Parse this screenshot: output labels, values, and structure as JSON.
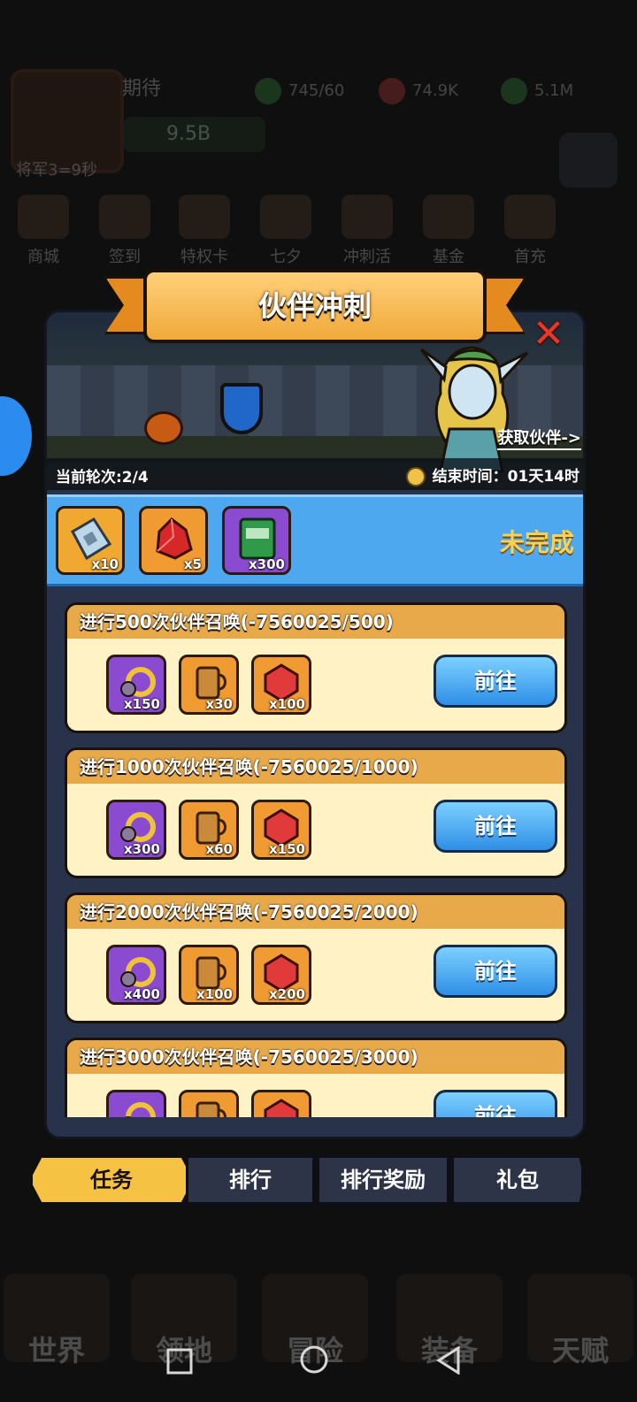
{
  "background": {
    "player_name": "期待",
    "power": "9.5B",
    "level_text": "将军3=9秒",
    "resources": [
      "745/60",
      "74.9K",
      "5.1M"
    ],
    "top_icons": [
      "商城",
      "签到",
      "特权卡",
      "七夕",
      "冲刺活动",
      "基金",
      "首充"
    ],
    "bottom_nav": [
      "世界",
      "领地",
      "冒险",
      "装备",
      "天赋"
    ]
  },
  "dialog": {
    "title": "伙伴冲刺",
    "get_partner_link": "获取伙伴->",
    "current_round": "当前轮次:2/4",
    "end_time": "结束时间：01天14时",
    "round_rewards": [
      {
        "icon": "ticket-icon",
        "count": "x10"
      },
      {
        "icon": "red-crystal-icon",
        "count": "x5"
      },
      {
        "icon": "exp-book-icon",
        "count": "x300"
      }
    ],
    "round_status": "未完成",
    "tasks": [
      {
        "title": "进行500次伙伴召唤(-7560025/500)",
        "button": "前往",
        "rewards": [
          {
            "icon": "summon-key-icon",
            "count": "x150"
          },
          {
            "icon": "beer-mug-icon",
            "count": "x30"
          },
          {
            "icon": "red-gem-icon",
            "count": "x100"
          }
        ]
      },
      {
        "title": "进行1000次伙伴召唤(-7560025/1000)",
        "button": "前往",
        "rewards": [
          {
            "icon": "summon-key-icon",
            "count": "x300"
          },
          {
            "icon": "beer-mug-icon",
            "count": "x60"
          },
          {
            "icon": "red-gem-icon",
            "count": "x150"
          }
        ]
      },
      {
        "title": "进行2000次伙伴召唤(-7560025/2000)",
        "button": "前往",
        "rewards": [
          {
            "icon": "summon-key-icon",
            "count": "x400"
          },
          {
            "icon": "beer-mug-icon",
            "count": "x100"
          },
          {
            "icon": "red-gem-icon",
            "count": "x200"
          }
        ]
      },
      {
        "title": "进行3000次伙伴召唤(-7560025/3000)",
        "button": "前往",
        "rewards": [
          {
            "icon": "summon-key-icon",
            "count": ""
          },
          {
            "icon": "beer-mug-icon",
            "count": ""
          },
          {
            "icon": "red-gem-icon",
            "count": ""
          }
        ]
      }
    ],
    "tabs": [
      "任务",
      "排行",
      "排行奖励",
      "礼包"
    ],
    "active_tab": "任务"
  },
  "colors": {
    "accent_blue": "#4ea8f0",
    "ribbon_orange": "#f0a93a",
    "status_yellow": "#f7d257",
    "card_bg": "#fff3c6",
    "close_red": "#e23a2a"
  }
}
